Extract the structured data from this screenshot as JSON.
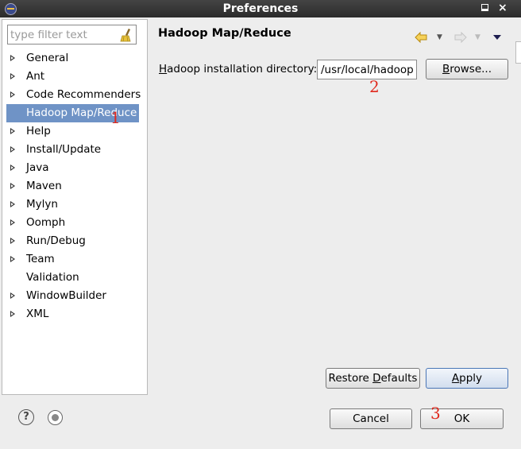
{
  "window": {
    "title": "Preferences"
  },
  "filter": {
    "placeholder": "type filter text"
  },
  "tree": {
    "items": [
      {
        "label": "General",
        "expandable": true
      },
      {
        "label": "Ant",
        "expandable": true
      },
      {
        "label": "Code Recommenders",
        "expandable": true
      },
      {
        "label": "Hadoop Map/Reduce",
        "expandable": false,
        "selected": true
      },
      {
        "label": "Help",
        "expandable": true
      },
      {
        "label": "Install/Update",
        "expandable": true
      },
      {
        "label": "Java",
        "expandable": true
      },
      {
        "label": "Maven",
        "expandable": true
      },
      {
        "label": "Mylyn",
        "expandable": true
      },
      {
        "label": "Oomph",
        "expandable": true
      },
      {
        "label": "Run/Debug",
        "expandable": true
      },
      {
        "label": "Team",
        "expandable": true
      },
      {
        "label": "Validation",
        "expandable": false
      },
      {
        "label": "WindowBuilder",
        "expandable": true
      },
      {
        "label": "XML",
        "expandable": true
      }
    ]
  },
  "page": {
    "title": "Hadoop Map/Reduce",
    "field_label_mnemonic": "H",
    "field_label_rest": "adoop installation directory:",
    "field_value": "/usr/local/hadoop",
    "browse_mnemonic": "B",
    "browse_rest": "rowse..."
  },
  "buttons": {
    "restore_pre": "Restore ",
    "restore_mnemonic": "D",
    "restore_post": "efaults",
    "apply_mnemonic": "A",
    "apply_rest": "pply",
    "cancel": "Cancel",
    "ok": "OK"
  },
  "annotations": {
    "a1": "1",
    "a2": "2",
    "a3": "3"
  },
  "colors": {
    "selection": "#6f93c6",
    "annotation": "#e0291d",
    "titlebar": "#2b2b2b"
  }
}
